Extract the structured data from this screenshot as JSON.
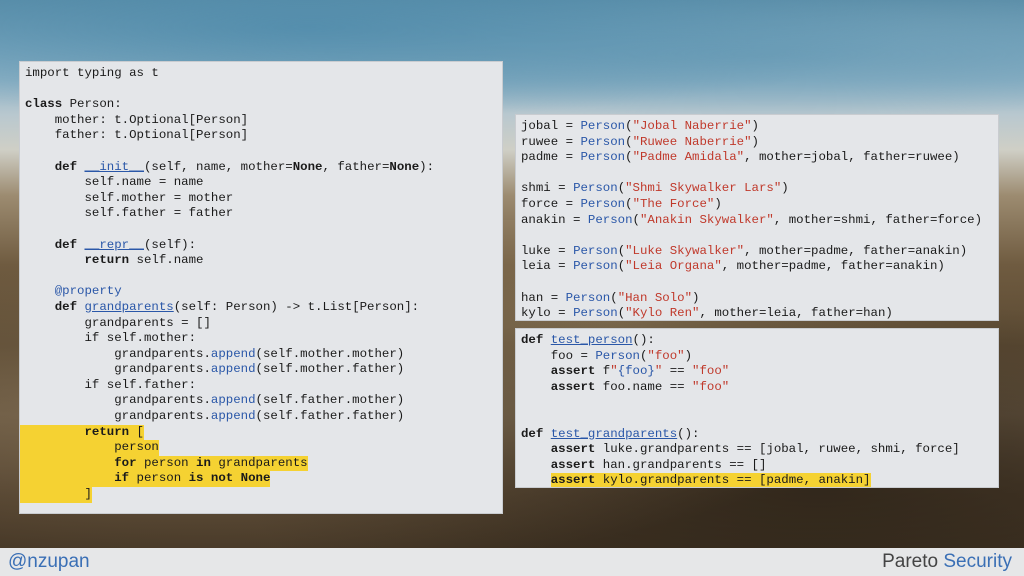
{
  "left_code": {
    "l1": "import typing as t",
    "l3a": "class",
    "l3b": " Person:",
    "l4": "    mother: t.Optional[Person]",
    "l5": "    father: t.Optional[Person]",
    "l7a": "    def ",
    "l7b": "__init__",
    "l7c": "(self, name, mother=",
    "l7d": "None",
    "l7e": ", father=",
    "l7f": "None",
    "l7g": "):",
    "l8": "        self.name = name",
    "l9": "        self.mother = mother",
    "l10": "        self.father = father",
    "l12a": "    def ",
    "l12b": "__repr__",
    "l12c": "(self):",
    "l13a": "        return",
    "l13b": " self.name",
    "l15": "    @property",
    "l16a": "    def ",
    "l16b": "grandparents",
    "l16c": "(self: Person) -> t.List[Person]:",
    "l17": "        grandparents = []",
    "l18": "        if self.mother:",
    "l19a": "            grandparents.",
    "l19b": "append",
    "l19c": "(self.mother.mother)",
    "l20a": "            grandparents.",
    "l20b": "append",
    "l20c": "(self.mother.father)",
    "l21": "        if self.father:",
    "l22a": "            grandparents.",
    "l22b": "append",
    "l22c": "(self.father.mother)",
    "l23a": "            grandparents.",
    "l23b": "append",
    "l23c": "(self.father.father)",
    "l24a": "        return",
    "l24b": " [",
    "l25": "            person",
    "l26a": "            for",
    "l26b": " person ",
    "l26c": "in",
    "l26d": " grandparents",
    "l27a": "            if",
    "l27b": " person ",
    "l27c": "is not None",
    "l28": "        ]"
  },
  "right1_code": [
    {
      "pre": "jobal = ",
      "cls": "Person",
      "open": "(",
      "str": "\"Jobal Naberrie\"",
      "rest": ")"
    },
    {
      "pre": "ruwee = ",
      "cls": "Person",
      "open": "(",
      "str": "\"Ruwee Naberrie\"",
      "rest": ")"
    },
    {
      "pre": "padme = ",
      "cls": "Person",
      "open": "(",
      "str": "\"Padme Amidala\"",
      "rest": ", mother=jobal, father=ruwee)"
    },
    {
      "pre": "",
      "cls": "",
      "open": "",
      "str": "",
      "rest": ""
    },
    {
      "pre": "shmi = ",
      "cls": "Person",
      "open": "(",
      "str": "\"Shmi Skywalker Lars\"",
      "rest": ")"
    },
    {
      "pre": "force = ",
      "cls": "Person",
      "open": "(",
      "str": "\"The Force\"",
      "rest": ")"
    },
    {
      "pre": "anakin = ",
      "cls": "Person",
      "open": "(",
      "str": "\"Anakin Skywalker\"",
      "rest": ", mother=shmi, father=force)"
    },
    {
      "pre": "",
      "cls": "",
      "open": "",
      "str": "",
      "rest": ""
    },
    {
      "pre": "luke = ",
      "cls": "Person",
      "open": "(",
      "str": "\"Luke Skywalker\"",
      "rest": ", mother=padme, father=anakin)"
    },
    {
      "pre": "leia = ",
      "cls": "Person",
      "open": "(",
      "str": "\"Leia Organa\"",
      "rest": ", mother=padme, father=anakin)"
    },
    {
      "pre": "",
      "cls": "",
      "open": "",
      "str": "",
      "rest": ""
    },
    {
      "pre": "han = ",
      "cls": "Person",
      "open": "(",
      "str": "\"Han Solo\"",
      "rest": ")"
    },
    {
      "pre": "kylo = ",
      "cls": "Person",
      "open": "(",
      "str": "\"Kylo Ren\"",
      "rest": ", mother=leia, father=han)"
    }
  ],
  "right2_code": {
    "t1a": "def",
    "t1b": " ",
    "t1c": "test_person",
    "t1d": "():",
    "t2a": "    foo = ",
    "t2b": "Person",
    "t2c": "(",
    "t2d": "\"foo\"",
    "t2e": ")",
    "t3a": "    assert",
    "t3b": " f",
    "t3c": "\"",
    "t3d": "{foo}",
    "t3e": "\"",
    "t3f": " == ",
    "t3g": "\"foo\"",
    "t4a": "    assert",
    "t4b": " foo.name == ",
    "t4c": "\"foo\"",
    "t7a": "def",
    "t7b": " ",
    "t7c": "test_grandparents",
    "t7d": "():",
    "t8a": "    assert",
    "t8b": " luke.grandparents == [jobal, ruwee, shmi, force]",
    "t9a": "    assert",
    "t9b": " han.grandparents == []",
    "t10a": "assert",
    "t10b": " kylo.grandparents == [padme, anakin]"
  },
  "footer": {
    "handle": "@nzupan",
    "brand_a": "Pareto ",
    "brand_b": "Security"
  },
  "colors": {
    "highlight": "#f5d232",
    "keyword_blue": "#2a57a8",
    "string_red": "#c0392b"
  }
}
